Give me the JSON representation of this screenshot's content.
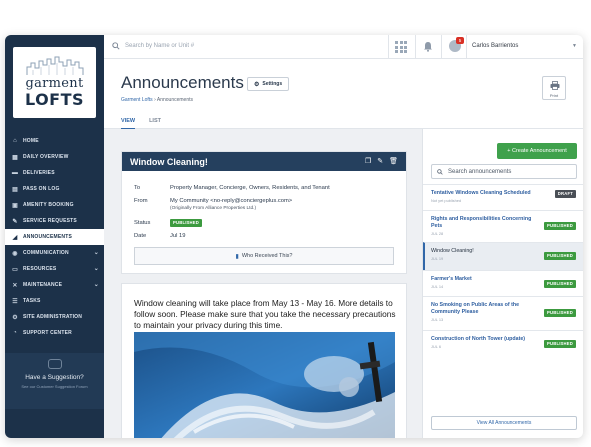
{
  "logo": {
    "line1": "garment",
    "line2": "LOFTS"
  },
  "sidebar": {
    "items": [
      {
        "label": "HOME",
        "icon": "home-icon",
        "glyph": "⌂"
      },
      {
        "label": "DAILY OVERVIEW",
        "icon": "calendar-icon",
        "glyph": "▦"
      },
      {
        "label": "DELIVERIES",
        "icon": "truck-icon",
        "glyph": "▬"
      },
      {
        "label": "PASS ON LOG",
        "icon": "document-icon",
        "glyph": "▤"
      },
      {
        "label": "AMENITY BOOKING",
        "icon": "booking-icon",
        "glyph": "▣"
      },
      {
        "label": "SERVICE REQUESTS",
        "icon": "wrench-icon",
        "glyph": "✎"
      },
      {
        "label": "ANNOUNCEMENTS",
        "icon": "megaphone-icon",
        "glyph": "◢",
        "active": true
      },
      {
        "label": "COMMUNICATION",
        "icon": "chat-icon",
        "glyph": "◉",
        "expandable": true
      },
      {
        "label": "RESOURCES",
        "icon": "folder-icon",
        "glyph": "▭",
        "expandable": true
      },
      {
        "label": "MAINTENANCE",
        "icon": "tools-icon",
        "glyph": "✕",
        "expandable": true
      },
      {
        "label": "TASKS",
        "icon": "tasks-icon",
        "glyph": "☰"
      },
      {
        "label": "SITE ADMINISTRATION",
        "icon": "admin-icon",
        "glyph": "⚙"
      },
      {
        "label": "SUPPORT CENTER",
        "icon": "help-icon",
        "glyph": "◔"
      }
    ],
    "suggestion": {
      "title": "Have a Suggestion?",
      "link": "See our Customer Suggestion Forum"
    }
  },
  "topbar": {
    "search_placeholder": "Search by Name or Unit #",
    "notification_count": "5",
    "user_name": "Carlos Barrientos"
  },
  "header": {
    "title": "Announcements",
    "settings_label": "Settings",
    "breadcrumb": {
      "parent": "Garment Lofts",
      "separator": "›",
      "current": "Announcements"
    },
    "print_label": "Print",
    "tabs": [
      {
        "label": "VIEW",
        "active": true
      },
      {
        "label": "LIST",
        "active": false
      }
    ]
  },
  "detail": {
    "title": "Window Cleaning!",
    "to_label": "To",
    "to_value": "Property Manager, Concierge, Owners, Residents, and Tenant",
    "from_label": "From",
    "from_value": "My Community <no-reply@conciergeplus.com>",
    "from_sub": "(Originally From Alliance Properties Ltd.)",
    "status_label": "Status",
    "status_value": "PUBLISHED",
    "date_label": "Date",
    "date_value": "Jul 19",
    "received_button": "Who Received This?"
  },
  "body": {
    "text": "Window cleaning will take place from May 13 - May 16. More details to follow soon. Please make sure that you take the necessary precautions to maintain your privacy during this time."
  },
  "rightpanel": {
    "create_button": "+ Create Announcement",
    "search_placeholder": "Search announcements",
    "items": [
      {
        "title": "Tentative Windows Cleaning Scheduled",
        "date": "Not yet published",
        "status": "DRAFT"
      },
      {
        "title": "Rights and Responsibilities Concerning Pets",
        "date": "JUL 28",
        "status": "PUBLISHED"
      },
      {
        "title": "Window Cleaning!",
        "date": "JUL 19",
        "status": "PUBLISHED",
        "active": true
      },
      {
        "title": "Farmer's Market",
        "date": "JUL 14",
        "status": "PUBLISHED"
      },
      {
        "title": "No Smoking on Public Areas of the Community Please",
        "date": "JUL 13",
        "status": "PUBLISHED"
      },
      {
        "title": "Construction of North Tower (update)",
        "date": "JUL 6",
        "status": "PUBLISHED"
      }
    ],
    "view_all": "View All Announcements"
  },
  "colors": {
    "navy": "#1c3149",
    "header_navy": "#25405e",
    "link_blue": "#3167a8",
    "published_green": "#3c9a3f",
    "create_green": "#3fa14c",
    "draft_gray": "#4a4f56"
  }
}
